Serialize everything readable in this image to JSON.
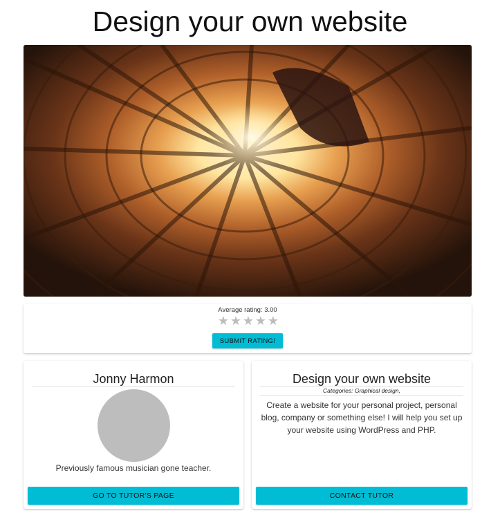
{
  "page": {
    "title": "Design your own website"
  },
  "hero": {
    "image_description_icon": "courtyard-photo"
  },
  "rating": {
    "average_label": "Average rating: 3.00",
    "stars": [
      "★",
      "★",
      "★",
      "★",
      "★"
    ],
    "submit_label": "SUBMIT RATING!"
  },
  "tutor": {
    "name": "Jonny Harmon",
    "description": "Previously famous musician gone teacher.",
    "button_label": "GO TO TUTOR'S PAGE"
  },
  "course": {
    "title": "Design your own website",
    "categories": "Categories: Graphical design,",
    "description": "Create a website for your personal project, personal blog, company or something else! I will help you set up your website using WordPress and PHP.",
    "button_label": "CONTACT TUTOR"
  },
  "colors": {
    "accent": "#00bcd4",
    "star_inactive": "#bdbdbd",
    "avatar_placeholder": "#bdbdbd"
  }
}
